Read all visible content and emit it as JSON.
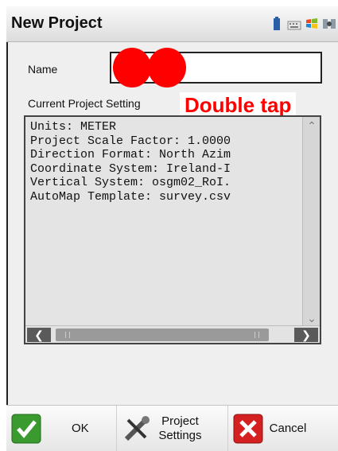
{
  "window": {
    "title": "New Project"
  },
  "form": {
    "name_label": "Name",
    "name_value": "",
    "current_settings_label": "Current Project Setting",
    "hint_text": "Double tap",
    "settings_lines": "Units: METER\nProject Scale Factor: 1.0000\nDirection Format: North Azim\nCoordinate System: Ireland-I\nVertical System: osgm02_RoI.\nAutoMap Template: survey.csv"
  },
  "toolbar": {
    "ok_label": "OK",
    "project_settings_label": "Project\nSettings",
    "cancel_label": "Cancel"
  },
  "icons": {
    "ok": "green-check-icon",
    "settings": "wrench-screwdriver-icon",
    "cancel": "red-x-icon",
    "tray": [
      "battery-icon",
      "keyboard-icon",
      "windows-flag-icon",
      "satellite-icon"
    ]
  },
  "colors": {
    "accent_red": "#ff0000",
    "ok_green": "#3a9a2f",
    "cancel_red": "#d42020"
  }
}
